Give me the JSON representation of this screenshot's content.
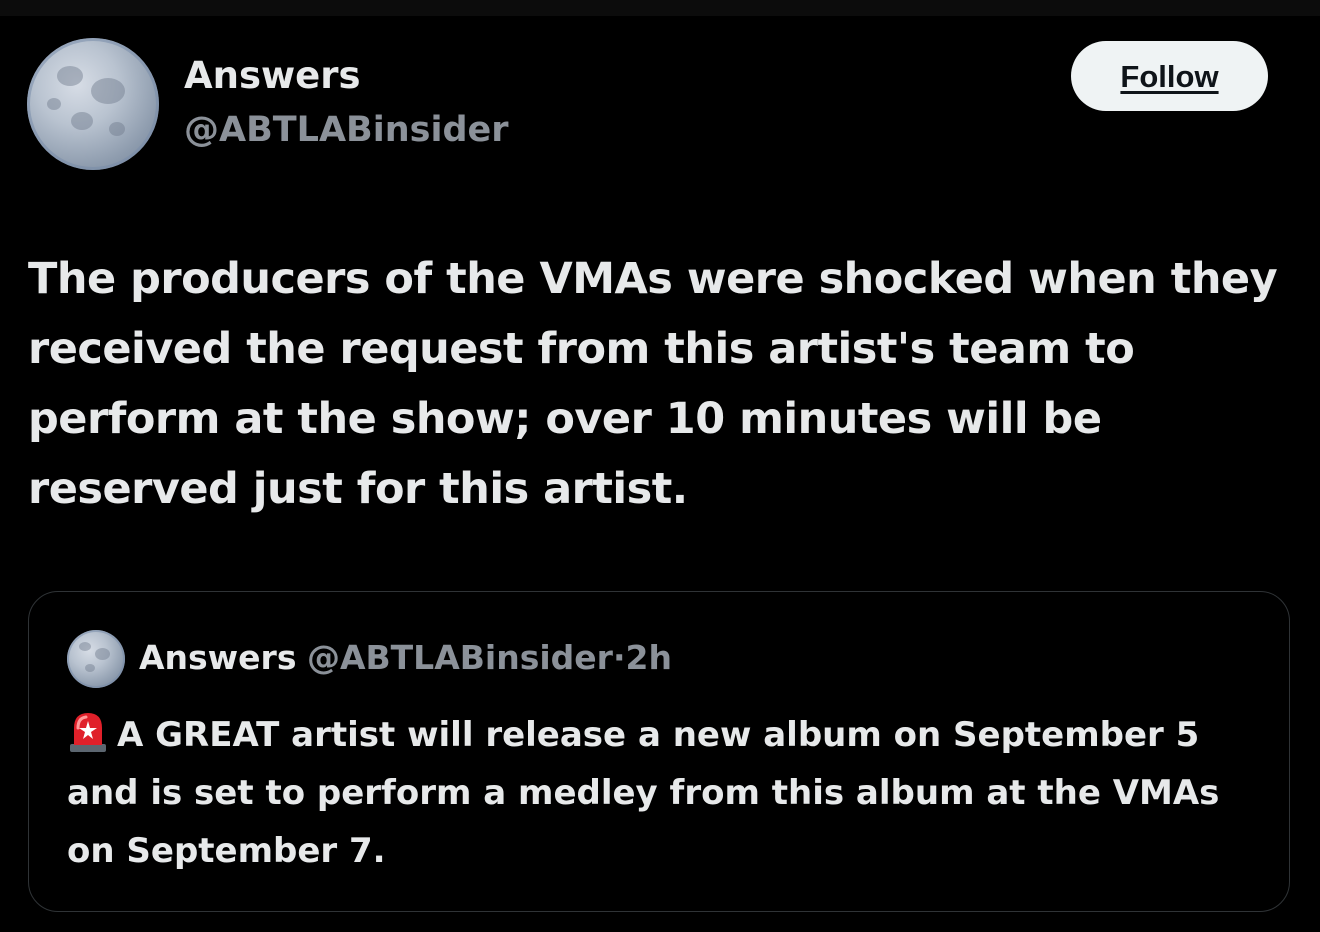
{
  "tweet": {
    "author": {
      "name": "Answers",
      "handle": "@ABTLABinsider",
      "avatar_icon": "moon-avatar"
    },
    "follow_label": "Follow",
    "text": "The producers of the VMAs were shocked when they received the request from this artist's team to perform at the show; over 10 minutes will be reserved just for this artist."
  },
  "quoted_tweet": {
    "author": {
      "name": "Answers",
      "handle": "@ABTLABinsider",
      "avatar_icon": "moon-avatar"
    },
    "separator": "·",
    "time": "2h",
    "emoji_icon": "police-siren-icon",
    "text": "A GREAT artist will release a new album on September 5 and is set to perform a medley from this album at the VMAs on September 7."
  },
  "colors": {
    "background": "#000000",
    "primary_text": "#e7e9ea",
    "secondary_text": "#8b9199",
    "border": "#2f3336",
    "button_bg": "#eff3f4",
    "siren_red": "#e0202a"
  }
}
